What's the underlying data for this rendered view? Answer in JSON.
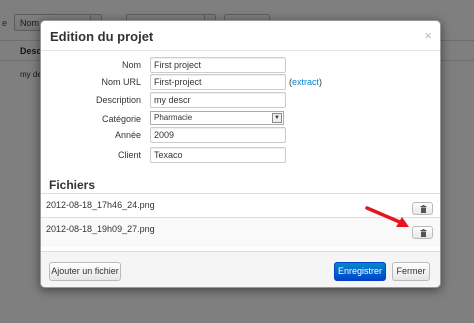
{
  "background": {
    "filter_label": "e",
    "filter_select_value": "Nom",
    "table_header": "Descr",
    "table_cell": "my de"
  },
  "modal": {
    "title": "Edition du projet",
    "close_label": "×",
    "fields": {
      "nom": {
        "label": "Nom",
        "value": "First project"
      },
      "nom_url": {
        "label": "Nom URL",
        "value": "First-project",
        "extract_open": "(",
        "extract_link": "extract",
        "extract_close": ")"
      },
      "description": {
        "label": "Description",
        "value": "my descr"
      },
      "categorie": {
        "label": "Catégorie",
        "value": "Pharmacie"
      },
      "annee": {
        "label": "Année",
        "value": "2009"
      },
      "client": {
        "label": "Client",
        "value": "Texaco"
      }
    },
    "files_title": "Fichiers",
    "files": [
      {
        "name": "2012-08-18_17h46_24.png"
      },
      {
        "name": "2012-08-18_19h09_27.png"
      }
    ],
    "footer": {
      "add_file": "Ajouter un fichier",
      "save": "Enregistrer",
      "close": "Fermer"
    }
  },
  "colors": {
    "primary": "#0044cc",
    "link": "#0088cc",
    "annotation_arrow": "#e8141c"
  }
}
